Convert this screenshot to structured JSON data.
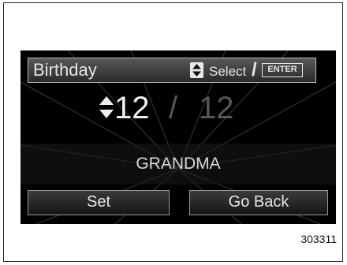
{
  "header": {
    "title": "Birthday",
    "select_label": "Select",
    "slash": "/",
    "enter_label": "ENTER",
    "updown_icon": "up-down-arrow-icon"
  },
  "date": {
    "month": "12",
    "separator": "/",
    "day": "12",
    "month_color": "#f0f0f0",
    "day_color": "#575757"
  },
  "entry_name": "GRANDMA",
  "buttons": {
    "set_label": "Set",
    "back_label": "Go Back"
  },
  "figure_code": "303311",
  "colors": {
    "screen_bg": "#000000",
    "text": "#e6e6e6"
  }
}
